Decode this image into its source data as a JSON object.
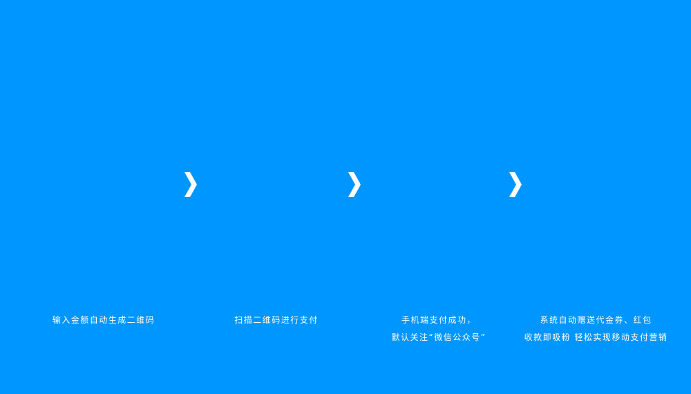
{
  "colors": {
    "background": "#0096FF",
    "foreground": "#FFFFFF"
  },
  "arrows": [
    {
      "icon": "chevron-right-icon"
    },
    {
      "icon": "chevron-right-icon"
    },
    {
      "icon": "chevron-right-icon"
    }
  ],
  "steps": [
    {
      "lines": [
        "输入金额自动生成二维码"
      ]
    },
    {
      "lines": [
        "扫描二维码进行支付"
      ]
    },
    {
      "lines": [
        "手机端支付成功，",
        "默认关注“微信公众号”"
      ]
    },
    {
      "lines": [
        "系统自动赠送代金券、红包",
        "收款即吸粉 轻松实现移动支付营销"
      ]
    }
  ]
}
